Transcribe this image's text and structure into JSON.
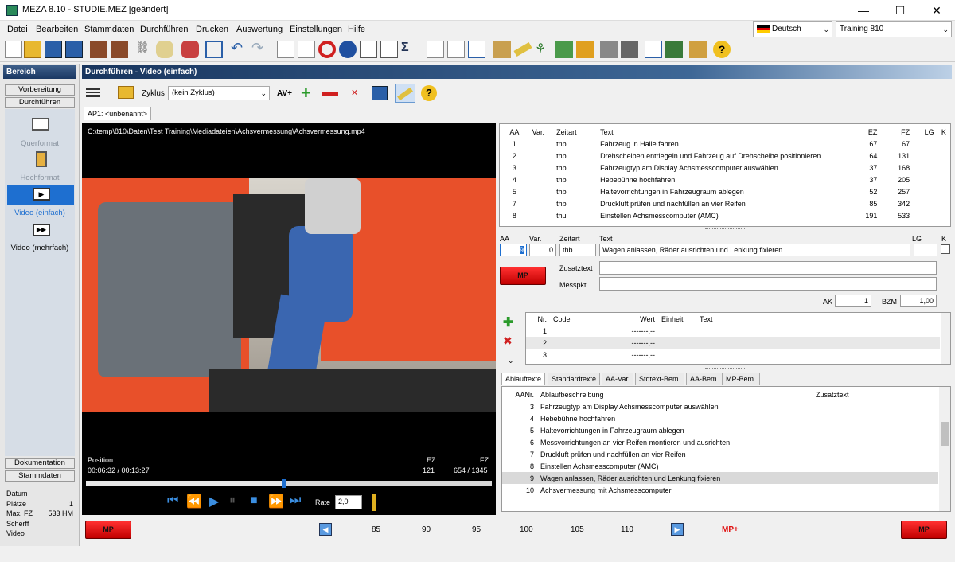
{
  "window": {
    "title": "MEZA 8.10 - STUDIE.MEZ [geändert]",
    "minimize": "—",
    "maximize": "☐",
    "close": "✕"
  },
  "menu": [
    "Datei",
    "Bearbeiten",
    "Stammdaten",
    "Durchführen",
    "Drucken",
    "Auswertung",
    "Einstellungen",
    "Hilfe"
  ],
  "language": {
    "value": "Deutsch"
  },
  "training": {
    "value": "Training 810"
  },
  "sidebar": {
    "header": "Bereich",
    "sections": [
      "Vorbereitung",
      "Durchführen"
    ],
    "items": [
      {
        "label": "Querformat",
        "icon": "landscape-icon",
        "active": false
      },
      {
        "label": "Hochformat",
        "icon": "portrait-icon",
        "active": false
      },
      {
        "label": "Video (einfach)",
        "icon": "video-icon",
        "active": true
      },
      {
        "label": "Video (mehrfach)",
        "icon": "video-multi-icon",
        "active": false
      }
    ],
    "bottom_sections": [
      "Dokumentation",
      "Stammdaten"
    ],
    "info": [
      {
        "label": "Datum",
        "value": ""
      },
      {
        "label": "Plätze",
        "value": "1"
      },
      {
        "label": "Max. FZ",
        "value": "533 HM"
      },
      {
        "label": "Scherff",
        "value": ""
      },
      {
        "label": "Video",
        "value": ""
      }
    ]
  },
  "content": {
    "header": "Durchführen - Video (einfach)",
    "zyklus_label": "Zyklus",
    "zyklus_value": "(kein Zyklus)",
    "av_label": "AV+",
    "tab_ap": "AP1: <unbenannt>"
  },
  "video": {
    "path": "C:\\temp\\810\\Daten\\Test Training\\Mediadateien\\Achsvermessung\\Achsvermessung.mp4",
    "position_label": "Position",
    "position_value": "00:06:32 / 00:13:27",
    "ez_label": "EZ",
    "ez_value": "121",
    "fz_label": "FZ",
    "fz_value": "654 / 1345",
    "progress": 0.486,
    "rate_label": "Rate",
    "rate_value": "2,0"
  },
  "steps_table": {
    "headers": [
      "AA",
      "Var.",
      "Zeitart",
      "Text",
      "EZ",
      "FZ",
      "LG",
      "K"
    ],
    "rows": [
      [
        "1",
        "",
        "tnb",
        "Fahrzeug in Halle fahren",
        "67",
        "67"
      ],
      [
        "2",
        "",
        "thb",
        "Drehscheiben entriegeln und Fahrzeug auf Drehscheibe positionieren",
        "64",
        "131"
      ],
      [
        "3",
        "",
        "thb",
        "Fahrzeugtyp am Display Achsmesscomputer auswählen",
        "37",
        "168"
      ],
      [
        "4",
        "",
        "thb",
        "Hebebühne hochfahren",
        "37",
        "205"
      ],
      [
        "5",
        "",
        "thb",
        "Haltevorrichtungen in Fahrzeugraum ablegen",
        "52",
        "257"
      ],
      [
        "7",
        "",
        "thb",
        "Druckluft prüfen und nachfüllen an vier Reifen",
        "85",
        "342"
      ],
      [
        "8",
        "",
        "thu",
        "Einstellen Achsmesscomputer (AMC)",
        "191",
        "533"
      ]
    ]
  },
  "editor": {
    "aa_label": "AA",
    "var_label": "Var.",
    "zeitart_label": "Zeitart",
    "text_label": "Text",
    "lg_label": "LG",
    "k_label": "K",
    "aa_value": "9",
    "var_value": "0",
    "zeitart_value": "thb",
    "text_value": "Wagen anlassen, Räder ausrichten und Lenkung fixieren",
    "zusatztext_label": "Zusatztext",
    "messpkt_label": "Messpkt.",
    "ak_label": "AK",
    "ak_value": "1",
    "bzm_label": "BZM",
    "bzm_value": "1,00",
    "mp_label": "MP"
  },
  "codes_table": {
    "headers": [
      "Nr.",
      "Code",
      "Wert",
      "Einheit",
      "Text"
    ],
    "rows": [
      [
        "1",
        "",
        "-------,--",
        "",
        ""
      ],
      [
        "2",
        "",
        "-------,--",
        "",
        ""
      ],
      [
        "3",
        "",
        "-------,--",
        "",
        ""
      ]
    ]
  },
  "bottom_tabs": [
    "Ablauftexte",
    "Standardtexte",
    "AA-Var.",
    "Stdtext-Bem.",
    "AA-Bem.",
    "MP-Bem."
  ],
  "ablauf_table": {
    "headers": [
      "AANr.",
      "Ablaufbeschreibung",
      "Zusatztext"
    ],
    "rows": [
      [
        "3",
        "Fahrzeugtyp am Display Achsmesscomputer auswählen"
      ],
      [
        "4",
        "Hebebühne hochfahren"
      ],
      [
        "5",
        "Haltevorrichtungen in Fahrzeugraum ablegen"
      ],
      [
        "6",
        "Messvorrichtungen an vier Reifen montieren und ausrichten"
      ],
      [
        "7",
        "Druckluft prüfen und nachfüllen an vier Reifen"
      ],
      [
        "8",
        "Einstellen Achsmesscomputer (AMC)"
      ],
      [
        "9",
        "Wagen anlassen, Räder ausrichten und Lenkung fixieren"
      ],
      [
        "10",
        "Achsvermessung mit Achsmesscomputer"
      ]
    ],
    "selected_row": 6
  },
  "bottom": {
    "mp_left": "MP",
    "timeline": [
      "85",
      "90",
      "95",
      "100",
      "105",
      "110"
    ],
    "mp_plus": "MP+",
    "mp_right": "MP"
  },
  "colors": {
    "accent": "#1e6fd0",
    "mp_red": "#e01010",
    "header_dark": "#1b3863"
  }
}
